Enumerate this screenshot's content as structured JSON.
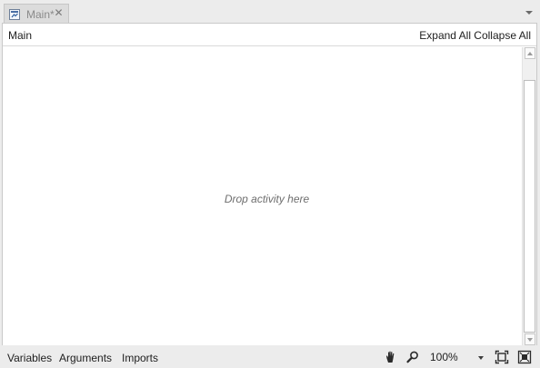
{
  "tab": {
    "label": "Main*",
    "close": "✕"
  },
  "breadcrumb": {
    "path": "Main"
  },
  "toolbar": {
    "expand_all": "Expand All",
    "collapse_all": "Collapse All"
  },
  "canvas": {
    "drop_hint": "Drop activity here"
  },
  "bottom_tabs": {
    "variables": "Variables",
    "arguments": "Arguments",
    "imports": "Imports"
  },
  "zoom": {
    "value": "100%"
  },
  "icons": {
    "tab": "workflow-file-icon",
    "pan": "hand-icon",
    "zoom": "magnifier-icon",
    "fit": "fit-to-screen-icon",
    "overview": "overview-icon"
  }
}
